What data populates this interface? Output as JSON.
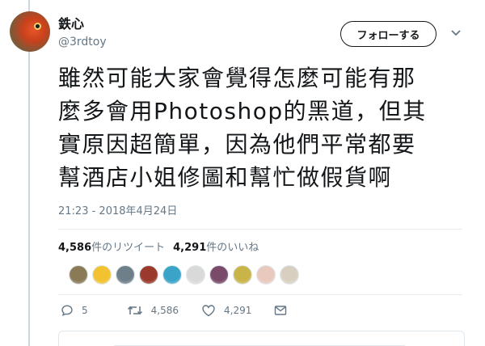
{
  "author": {
    "display_name": "鉄心",
    "handle": "@3rdtoy"
  },
  "follow_button_label": "フォローする",
  "tweet": {
    "lines": [
      "雖然可能大家會覺得怎麼可能有那",
      "麼多會用Photoshop的黑道，但其",
      "實原因超簡單，因為他們平常都要",
      "幫酒店小姐修圖和幫忙做假貨啊"
    ],
    "timestamp": "21:23 - 2018年4月24日"
  },
  "stats": {
    "retweet_count": "4,586",
    "retweet_label": "件のリツイート",
    "like_count": "4,291",
    "like_label": "件のいいね"
  },
  "liker_avatar_colors": [
    "#8a7a55",
    "#f2c230",
    "#6f7f8a",
    "#9b3a2c",
    "#3aa3c8",
    "#d9d9d9",
    "#7a4a6a",
    "#c9b44a",
    "#e9c8bd",
    "#d8cfc0"
  ],
  "actions": {
    "reply_count": "5",
    "retweet_count": "4,586",
    "like_count": "4,291"
  },
  "icons": [
    "reply-icon",
    "retweet-icon",
    "heart-icon",
    "message-icon",
    "chevron-down-icon"
  ],
  "colors": {
    "text_primary": "#14171a",
    "text_secondary": "#657786",
    "border": "#e6ecf0"
  }
}
